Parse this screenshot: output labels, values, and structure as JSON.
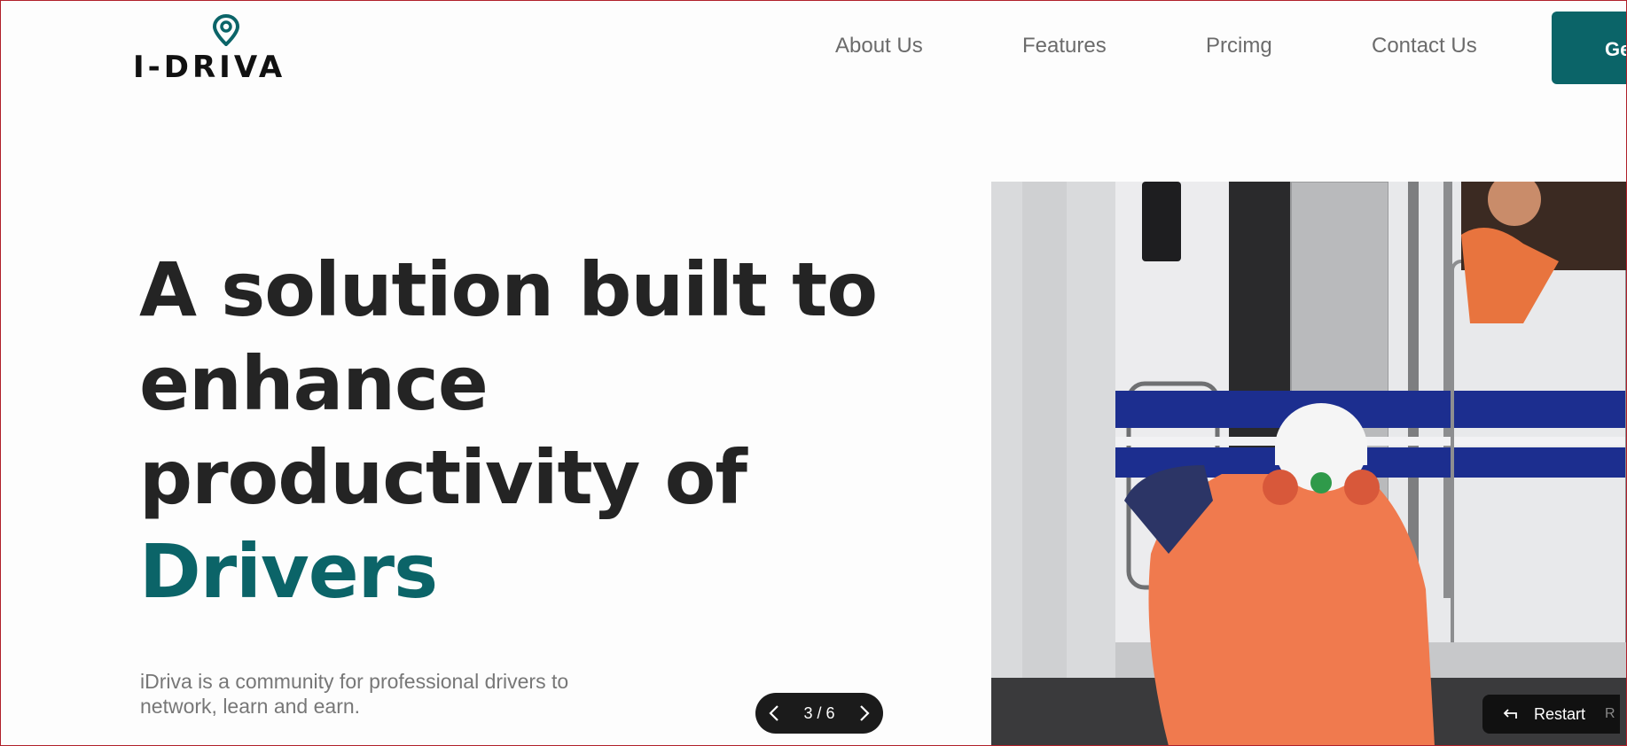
{
  "brand": {
    "name": "I-DRIVA",
    "accent_color": "#0b6468"
  },
  "nav": {
    "items": [
      {
        "label": "About Us"
      },
      {
        "label": "Features"
      },
      {
        "label": "Prcimg"
      },
      {
        "label": "Contact Us"
      }
    ],
    "cta_label": "Ge"
  },
  "hero": {
    "headline_line1": "A solution built to",
    "headline_line2": "enhance",
    "headline_line3": "productivity of",
    "headline_accent": "Drivers",
    "subtext": "iDriva is a community for professional drivers to network, learn and earn."
  },
  "pager": {
    "counter": "3 / 6",
    "prev_icon": "chevron-left-icon",
    "next_icon": "chevron-right-icon"
  },
  "restart": {
    "label": "Restart",
    "shortcut": "R",
    "icon": "return-arrow-icon"
  }
}
